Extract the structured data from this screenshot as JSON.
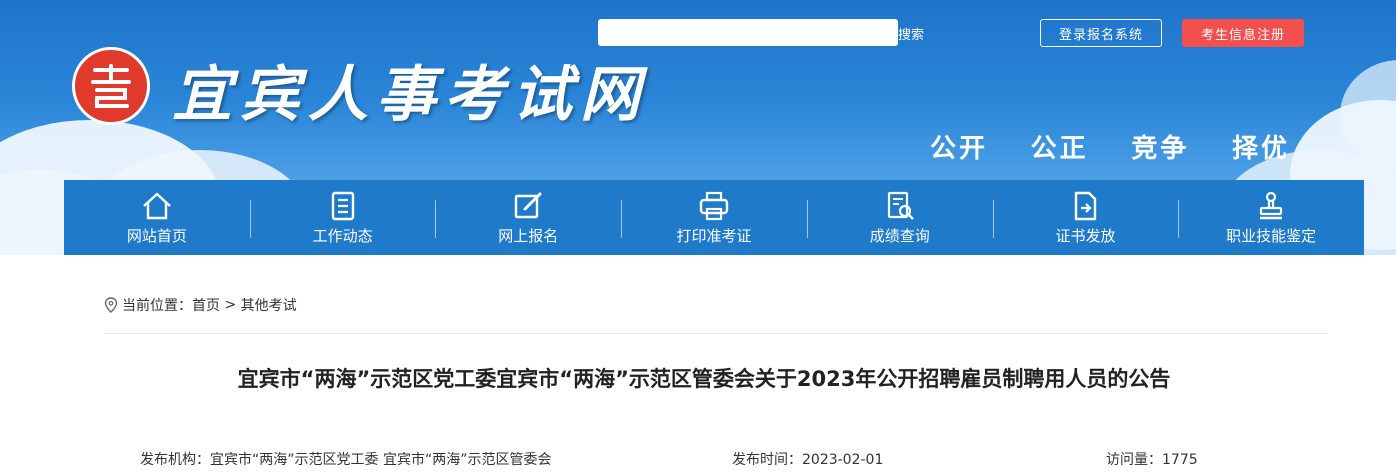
{
  "header": {
    "site_title": "宜宾人事考试网",
    "search_placeholder": "",
    "search_button": "搜索",
    "login_button": "登录报名系统",
    "register_button": "考生信息注册",
    "slogans": [
      "公开",
      "公正",
      "竞争",
      "择优"
    ]
  },
  "nav": {
    "items": [
      {
        "label": "网站首页",
        "icon": "home-icon"
      },
      {
        "label": "工作动态",
        "icon": "document-list-icon"
      },
      {
        "label": "网上报名",
        "icon": "edit-icon"
      },
      {
        "label": "打印准考证",
        "icon": "printer-icon"
      },
      {
        "label": "成绩查询",
        "icon": "search-document-icon"
      },
      {
        "label": "证书发放",
        "icon": "certificate-icon"
      },
      {
        "label": "职业技能鉴定",
        "icon": "stamp-icon"
      }
    ]
  },
  "breadcrumb": {
    "prefix": "当前位置：",
    "home": "首页",
    "separator": " > ",
    "current": "其他考试"
  },
  "article": {
    "title": "宜宾市“两海”示范区党工委宜宾市“两海”示范区管委会关于2023年公开招聘雇员制聘用人员的公告",
    "org_label": "发布机构：",
    "org_value": "宜宾市“两海”示范区党工委 宜宾市“两海”示范区管委会",
    "date_label": "发布时间：",
    "date_value": "2023-02-01",
    "views_label": "访问量：",
    "views_value": "1775"
  },
  "colors": {
    "nav_bg": "#1f7ac9",
    "register_bg": "#f34f4f",
    "logo_red": "#e03a2c"
  }
}
